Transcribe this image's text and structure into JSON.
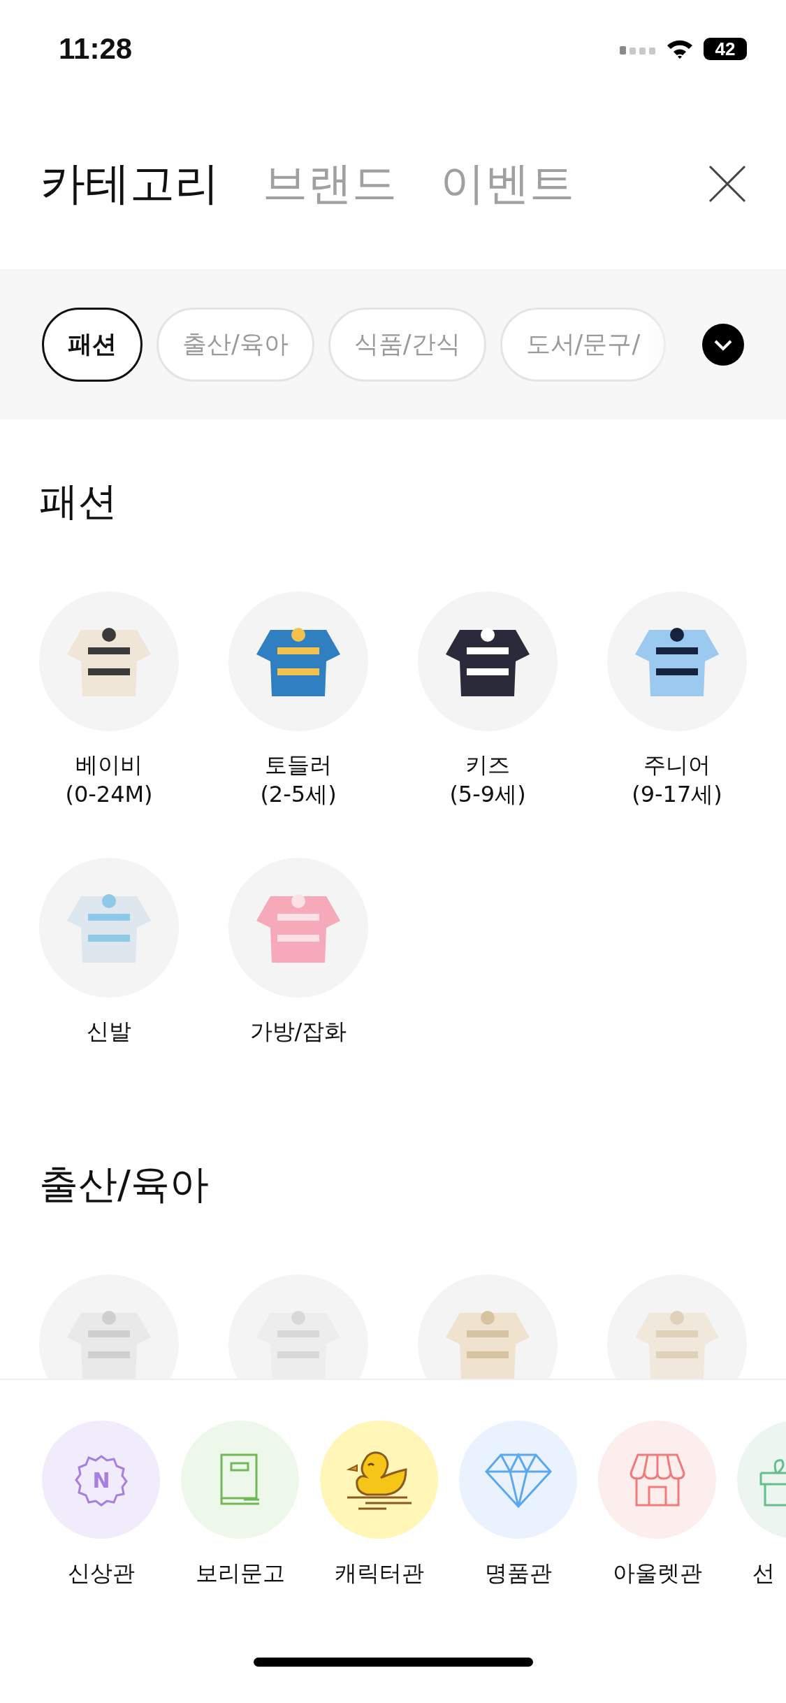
{
  "status_bar": {
    "time": "11:28",
    "battery": "42"
  },
  "tabs": [
    {
      "label": "카테고리",
      "selected": true
    },
    {
      "label": "브랜드",
      "selected": false
    },
    {
      "label": "이벤트",
      "selected": false
    }
  ],
  "chips": [
    {
      "label": "패션",
      "selected": true
    },
    {
      "label": "출산/육아",
      "selected": false
    },
    {
      "label": "식품/간식",
      "selected": false
    },
    {
      "label": "도서/문구/",
      "selected": false
    }
  ],
  "sections": [
    {
      "title": "패션",
      "items": [
        {
          "label": "베이비\n(0-24M)",
          "kind": "picture"
        },
        {
          "label": "토들러\n(2-5세)",
          "kind": "picture"
        },
        {
          "label": "키즈\n(5-9세)",
          "kind": "picture"
        },
        {
          "label": "주니어\n(9-17세)",
          "kind": "picture"
        },
        {
          "label": "신발",
          "kind": "picture"
        },
        {
          "label": "가방/잡화",
          "kind": "picture"
        }
      ]
    },
    {
      "title": "출산/육아"
    }
  ],
  "shortcuts": [
    {
      "label": "신상관",
      "kind": "badge",
      "icon_text": "N",
      "color": "#f1ecfb"
    },
    {
      "label": "보리문고",
      "kind": "book",
      "color": "#eef8ea"
    },
    {
      "label": "캐릭터관",
      "kind": "duck",
      "color": "#fff6b8"
    },
    {
      "label": "명품관",
      "kind": "diamond",
      "color": "#eaf3fd"
    },
    {
      "label": "아울렛관",
      "kind": "store",
      "color": "#fdeeee"
    },
    {
      "label": "선",
      "kind": "gift",
      "color": "#ecf5ef"
    }
  ]
}
